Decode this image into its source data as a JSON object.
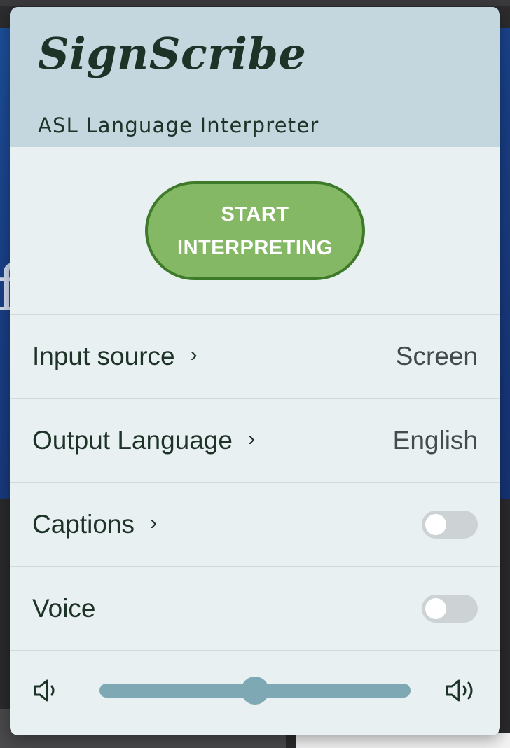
{
  "app": {
    "name": "SignScribe",
    "tagline": "ASL Language Interpreter"
  },
  "start_button": {
    "label": "START INTERPRETING"
  },
  "settings": {
    "input_source": {
      "label": "Input source",
      "value": "Screen"
    },
    "output_language": {
      "label": "Output Language",
      "value": "English"
    },
    "captions": {
      "label": "Captions",
      "enabled": false
    },
    "voice": {
      "label": "Voice",
      "enabled": false
    }
  },
  "volume": {
    "level": 0.5
  },
  "background_page": {
    "glyph": "f"
  },
  "colors": {
    "header_bg": "#c5d7de",
    "panel_bg": "#e8f0f2",
    "button_fill": "#85b864",
    "button_border": "#3d7a2a",
    "text_dark": "#1e3328",
    "slider": "#7ea8b4",
    "toggle_off": "#cdd2d4"
  },
  "icons": {
    "chevron": "chevron-right-icon",
    "volume_low": "speaker-low-icon",
    "volume_high": "speaker-high-icon"
  }
}
